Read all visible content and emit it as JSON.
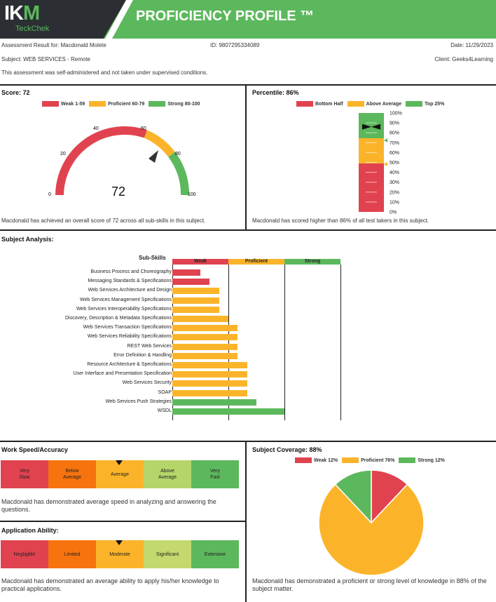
{
  "header": {
    "logo_main": "IK",
    "logo_m": "M",
    "logo_sub": "TeckChek",
    "title": "PROFICIENCY PROFILE ™"
  },
  "meta": {
    "assessment": "Assessment Result for: Macdonald Molete",
    "id": "ID: 9807295334089",
    "date": "Date: 11/29/2023",
    "subject": "Subject: WEB SERVICES - Remote",
    "client": "Client: Geeks4Learning",
    "note": "This assessment was self-administered and not taken under supervised conditions."
  },
  "colors": {
    "red": "#e0434f",
    "orange": "#fbb42a",
    "green": "#5cb85c",
    "dark_orange": "#f7730e",
    "light_green": "#b5d56a",
    "grey_green": "#c3d96e"
  },
  "score": {
    "title": "Score: 72",
    "value": "72",
    "score_value": 72,
    "legend": [
      "Weak 1-59",
      "Proficient 60-79",
      "Strong 80-100"
    ],
    "ticks": [
      "0",
      "20",
      "40",
      "60",
      "80",
      "100"
    ],
    "text": "Macdonald has achieved an overall score of 72 across all sub-skills in this subject."
  },
  "percentile": {
    "title": "Percentile: 86%",
    "value": 86,
    "legend": [
      "Bottom Half",
      "Above Average",
      "Top 25%"
    ],
    "ticks": [
      "100%",
      "90%",
      "80%",
      "70%",
      "60%",
      "50%",
      "40%",
      "30%",
      "20%",
      "10%",
      "0%"
    ],
    "text": "Macdonald has scored higher than 86% of all test takers in this subject."
  },
  "analysis": {
    "title": "Subject Analysis:",
    "subskills_header": "Sub-Skills",
    "bands": [
      "Weak",
      "Proficient",
      "Strong"
    ],
    "chart_data": {
      "type": "bar",
      "categories": [
        "Business Process and Choreography",
        "Messaging Standards & Specifications",
        "Web Services Architecture and Design",
        "Web Services Management Specifications",
        "Web Services Interoperability Specifications",
        "Discovery, Description & Metadata Specifications",
        "Web Services Transaction Specifications",
        "Web Services Reliability Specifications",
        "REST Web Services",
        "Error Definition & Handling",
        "Resource Architecture & Specifications",
        "User Interface and Presentation Specification",
        "Web Services Security",
        "SOAP",
        "Web Services Push Strategies",
        "WSDL"
      ],
      "values": [
        30,
        40,
        50,
        50,
        50,
        60,
        70,
        70,
        70,
        70,
        80,
        80,
        80,
        80,
        90,
        120
      ],
      "xlim": [
        0,
        120
      ]
    }
  },
  "speed": {
    "title": "Work Speed/Accuracy",
    "cells": [
      "Very\nSlow",
      "Below\nAverage",
      "Average",
      "Above\nAverage",
      "Very\nFast"
    ],
    "selected": 2,
    "text": "Macdonald has demonstrated average speed in analyzing and answering the questions."
  },
  "application": {
    "title": "Application Ability:",
    "cells": [
      "Negligible",
      "Limited",
      "Moderate",
      "Significant",
      "Extensive"
    ],
    "selected": 2,
    "text": "Macdonald has demonstrated an average ability to apply his/her knowledge to practical applications."
  },
  "coverage": {
    "title": "Subject Coverage: 88%",
    "legend": [
      "Weak 12%",
      "Proficient 76%",
      "Strong 12%"
    ],
    "chart_data": {
      "type": "pie",
      "labels": [
        "Weak",
        "Proficient",
        "Strong"
      ],
      "values": [
        12,
        76,
        12
      ]
    },
    "text": "Macdonald has demonstrated a proficient or strong level of knowledge in 88% of the subject matter."
  }
}
